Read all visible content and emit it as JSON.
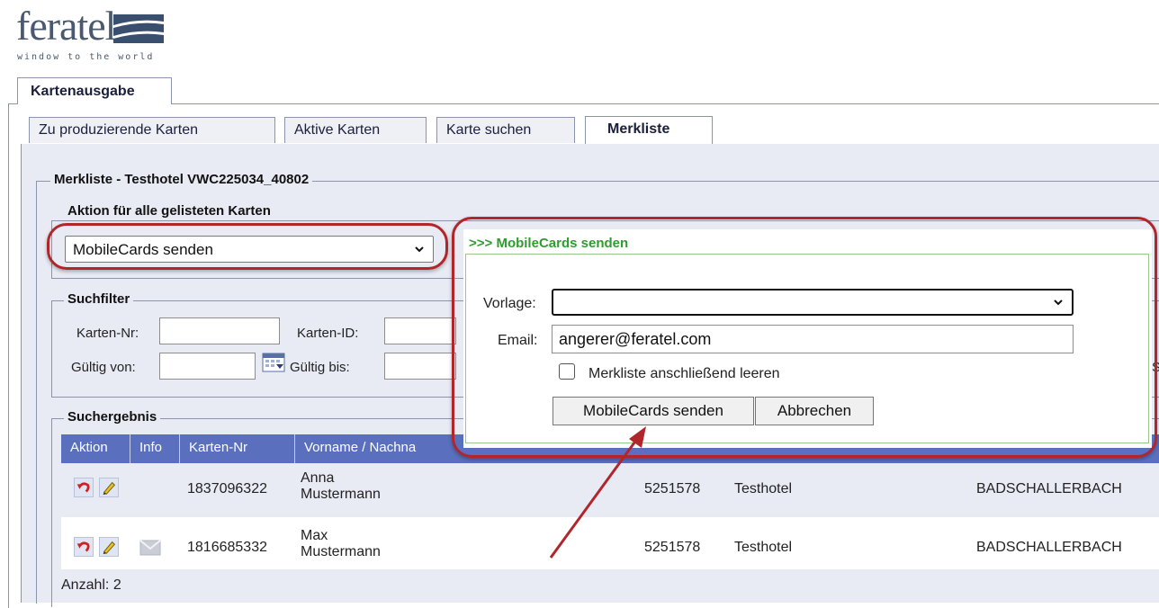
{
  "brand": {
    "name": "feratel",
    "tagline": "window to the world"
  },
  "main_tab": {
    "label": "Kartenausgabe"
  },
  "subtabs": [
    {
      "label": "Zu produzierende Karten"
    },
    {
      "label": "Aktive Karten"
    },
    {
      "label": "Karte suchen"
    },
    {
      "label": "Merkliste"
    }
  ],
  "merkliste": {
    "legend": "Merkliste - Testhotel VWC225034_40802"
  },
  "aktion": {
    "legend": "Aktion für alle gelisteten Karten",
    "selected": "MobileCards senden"
  },
  "suchfilter": {
    "legend": "Suchfilter",
    "karten_nr_label": "Karten-Nr:",
    "karten_id_label": "Karten-ID:",
    "gueltig_von_label": "Gültig von:",
    "gueltig_bis_label": "Gültig bis:",
    "cut_label": "S"
  },
  "suchergebnis": {
    "legend": "Suchergebnis",
    "headers": [
      "Aktion",
      "Info",
      "Karten-Nr",
      "Vorname / Nachna"
    ],
    "rows": [
      {
        "karten_nr": "1837096322",
        "vorname": "Anna",
        "nachname": "Mustermann",
        "nummer": "5251578",
        "hotel": "Testhotel",
        "ort": "BADSCHALLERBACH",
        "info_icon": ""
      },
      {
        "karten_nr": "1816685332",
        "vorname": "Max",
        "nachname": "Mustermann",
        "nummer": "5251578",
        "hotel": "Testhotel",
        "ort": "BADSCHALLERBACH",
        "info_icon": "envelope-icon"
      }
    ],
    "count": "Anzahl: 2"
  },
  "dialog": {
    "title": ">>> MobileCards senden",
    "vorlage_label": "Vorlage:",
    "vorlage_value": "",
    "email_label": "Email:",
    "email_value": "angerer@feratel.com",
    "clear_label": "Merkliste anschließend leeren",
    "clear_checked": false,
    "send_button": "MobileCards senden",
    "cancel_button": "Abbrechen"
  },
  "colors": {
    "header_bg": "#5b6fbf",
    "panel_bg": "#e8ebf4",
    "highlight": "#b0262b",
    "dialog_title": "#2e9d2e"
  }
}
